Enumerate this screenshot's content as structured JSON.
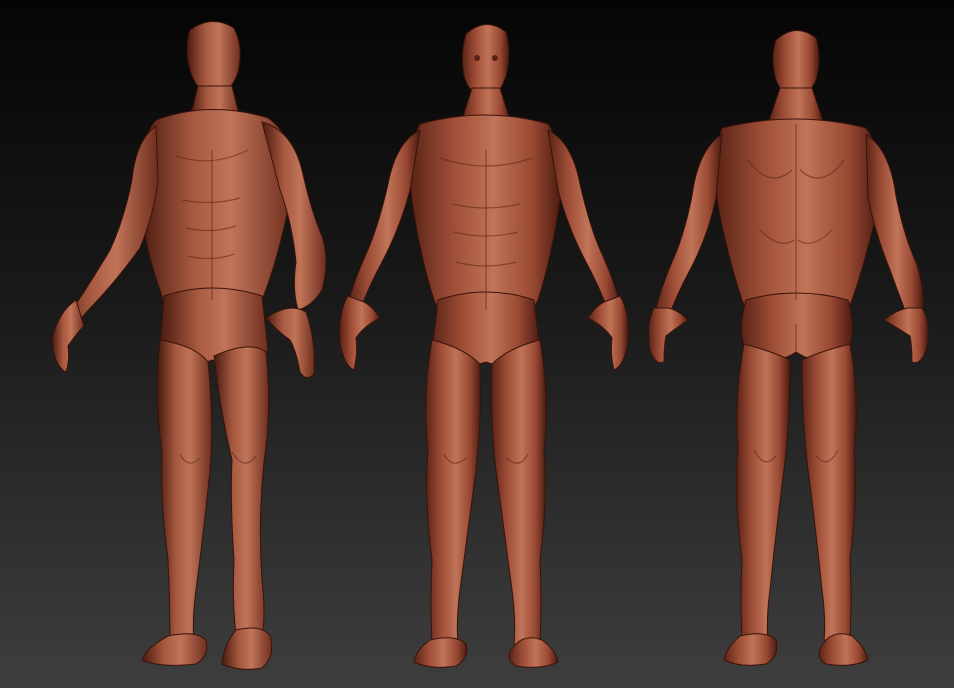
{
  "scene": {
    "subject": "sculpted-humanoid-figure",
    "views": [
      "three-quarter-front",
      "front",
      "back"
    ],
    "colors": {
      "background_top": "#050505",
      "background_bottom": "#3e3e3e",
      "skin_light": "#c07458",
      "skin_mid": "#9a4a33",
      "skin_dark": "#4a1a10"
    }
  }
}
